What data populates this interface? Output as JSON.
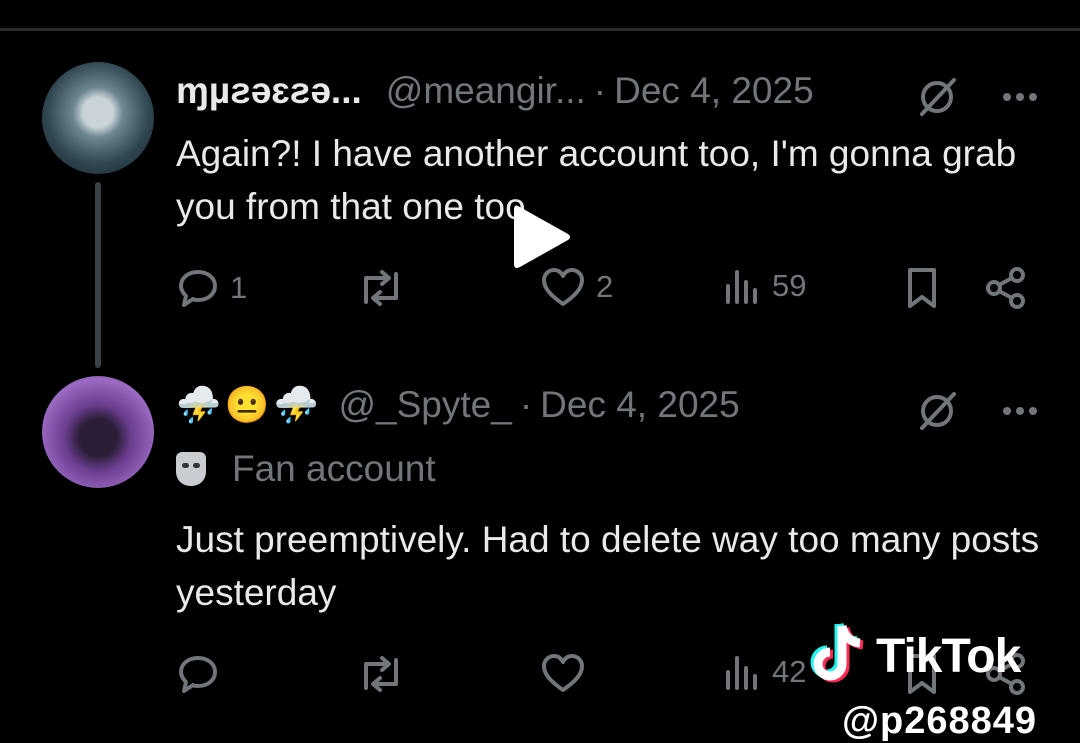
{
  "tweets": [
    {
      "display_name": "ɱµƨəɛƨə...",
      "handle": "@meangir...",
      "separator": "·",
      "date": "Dec 4, 2025",
      "text": "Again?! I have another account too, I'm gonna grab you from that one too",
      "actions": {
        "replies": "1",
        "reposts": "",
        "likes": "2",
        "views": "59"
      }
    },
    {
      "display_name_emojis": [
        "⛈️",
        "😐",
        "⛈️"
      ],
      "handle": "@_Spyte_",
      "separator": "·",
      "date": "Dec 4, 2025",
      "label": "Fan account",
      "text": "Just preemptively. Had to delete way too many posts yesterday",
      "actions": {
        "replies": "",
        "reposts": "",
        "likes": "",
        "views": "42"
      }
    }
  ],
  "watermark": {
    "brand": "TikTok",
    "handle": "@p268849"
  },
  "icons": [
    "reply-icon",
    "repost-icon",
    "like-icon",
    "views-icon",
    "bookmark-icon",
    "share-icon",
    "grok-icon",
    "more-icon",
    "play-icon",
    "tiktok-logo-icon",
    "fan-account-icon"
  ],
  "colors": {
    "background": "#000000",
    "text": "#e7e9ea",
    "muted": "#71767b"
  }
}
